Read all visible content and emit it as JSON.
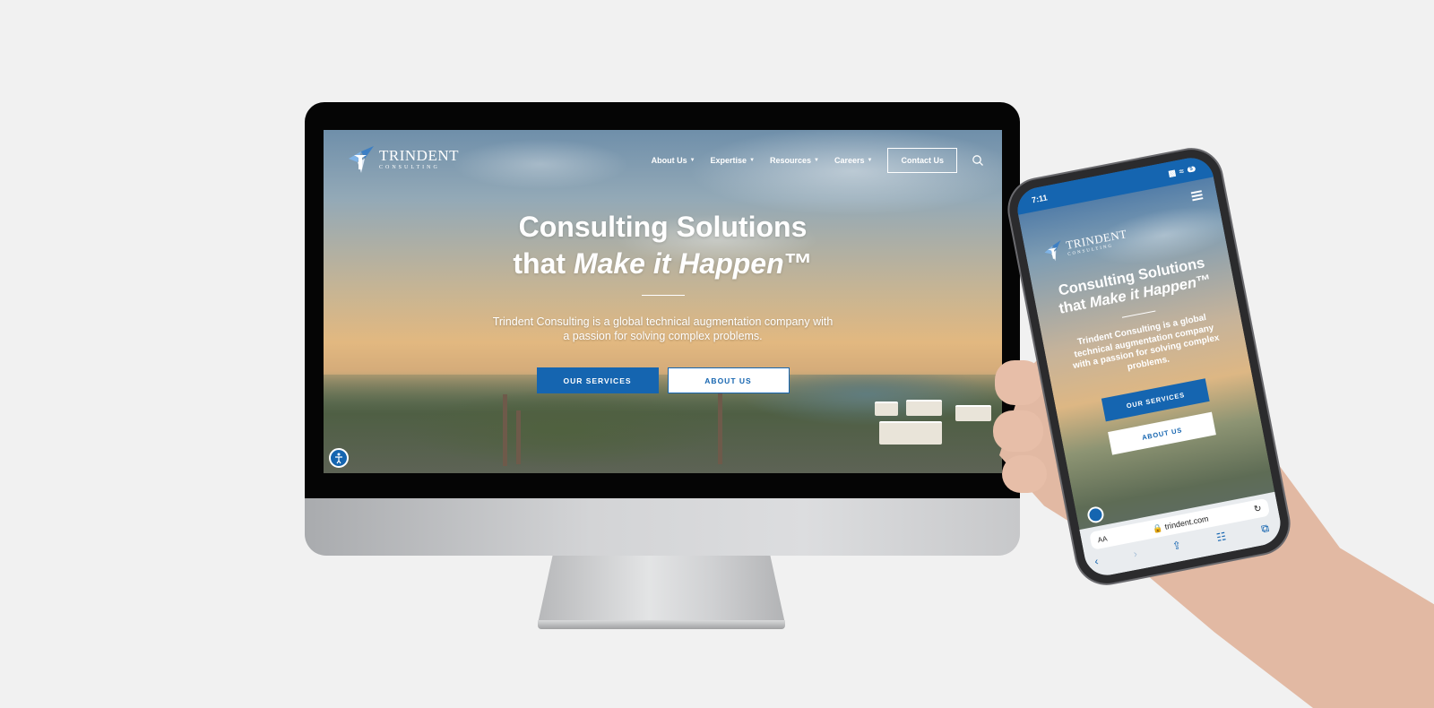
{
  "desktop": {
    "logo": {
      "name": "TRINDENT",
      "tagline": "CONSULTING"
    },
    "nav": {
      "items": [
        {
          "label": "About Us"
        },
        {
          "label": "Expertise"
        },
        {
          "label": "Resources"
        },
        {
          "label": "Careers"
        }
      ],
      "contact_label": "Contact Us"
    },
    "hero": {
      "title_line1": "Consulting Solutions",
      "title_line2_plain": "that ",
      "title_line2_italic": "Make it Happen",
      "title_tm": "™",
      "description": "Trindent Consulting is a global technical augmentation company with a passion for solving complex problems.",
      "primary_button": "OUR SERVICES",
      "secondary_button": "ABOUT US"
    }
  },
  "mobile": {
    "status_time": "7:11",
    "battery": "5",
    "logo": {
      "name": "TRINDENT",
      "tagline": "CONSULTING"
    },
    "hero": {
      "title_line1": "Consulting Solutions",
      "title_line2_plain": "that ",
      "title_line2_italic": "Make it Happen",
      "title_tm": "™",
      "description": "Trindent Consulting is a global technical augmentation company with a passion for solving complex problems.",
      "primary_button": "OUR SERVICES",
      "secondary_button": "ABOUT US"
    },
    "browser": {
      "text_size_label": "AA",
      "url": "trindent.com"
    }
  },
  "colors": {
    "brand_blue": "#1565b0",
    "page_background": "#f1f1f1"
  },
  "icons": [
    "search-icon",
    "accessibility-icon",
    "hamburger-icon",
    "lock-icon",
    "reload-icon",
    "share-icon",
    "bookmarks-icon",
    "tabs-icon"
  ]
}
